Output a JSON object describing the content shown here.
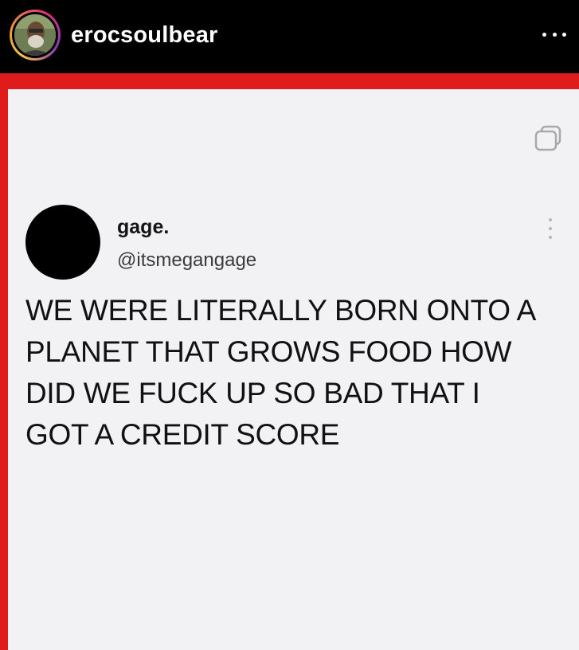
{
  "instagram": {
    "username": "erocsoulbear",
    "avatar_icon": "profile-photo-avatar",
    "more_icon": "more-horizontal-icon",
    "story_ring_colors": [
      "#f5c544",
      "#f08a3a",
      "#d8307b",
      "#8a3ab9"
    ]
  },
  "frame": {
    "border_color": "#e01b1b",
    "card_color": "#f2f2f4"
  },
  "tweet": {
    "display_name": "gage.",
    "handle": "@itsmegangage",
    "avatar_color": "#000000",
    "copy_icon": "copy-icon",
    "menu_icon": "more-vertical-icon",
    "text_lines": [
      "WE WERE LITERALLY BORN ONTO A",
      "PLANET THAT GROWS FOOD HOW",
      "DID WE FUCK UP SO BAD THAT I",
      "GOT A CREDIT SCORE"
    ]
  }
}
